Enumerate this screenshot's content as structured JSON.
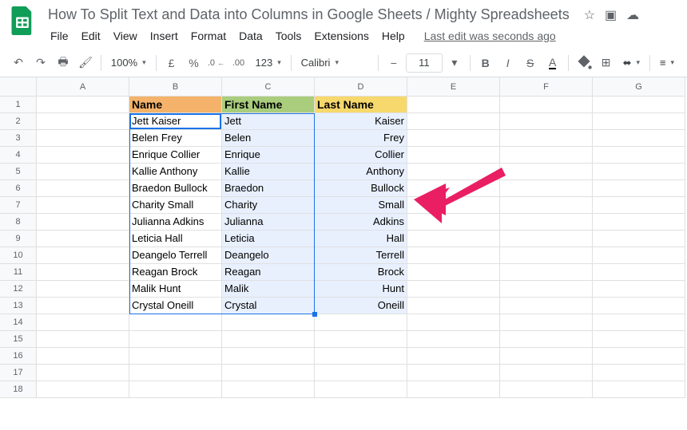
{
  "title": "How To Split Text and Data into Columns in Google Sheets / Mighty Spreadsheets",
  "lastEdit": "Last edit was seconds ago",
  "menus": [
    "File",
    "Edit",
    "View",
    "Insert",
    "Format",
    "Data",
    "Tools",
    "Extensions",
    "Help"
  ],
  "toolbar": {
    "zoom": "100%",
    "currency": "£",
    "percent": "%",
    "dec_dec": ".0",
    "dec_inc": ".00",
    "moreformats": "123",
    "font": "Calibri",
    "fontsize": "11"
  },
  "columns": [
    "A",
    "B",
    "C",
    "D",
    "E",
    "F",
    "G"
  ],
  "headers": {
    "name": "Name",
    "first": "First Name",
    "last": "Last Name"
  },
  "rows": [
    {
      "name": "Jett Kaiser",
      "first": "Jett",
      "last": "Kaiser"
    },
    {
      "name": "Belen Frey",
      "first": "Belen",
      "last": "Frey"
    },
    {
      "name": "Enrique Collier",
      "first": "Enrique",
      "last": "Collier"
    },
    {
      "name": "Kallie Anthony",
      "first": "Kallie",
      "last": "Anthony"
    },
    {
      "name": "Braedon Bullock",
      "first": "Braedon",
      "last": "Bullock"
    },
    {
      "name": "Charity Small",
      "first": "Charity",
      "last": "Small"
    },
    {
      "name": "Julianna Adkins",
      "first": "Julianna",
      "last": "Adkins"
    },
    {
      "name": "Leticia Hall",
      "first": "Leticia",
      "last": "Hall"
    },
    {
      "name": "Deangelo Terrell",
      "first": "Deangelo",
      "last": "Terrell"
    },
    {
      "name": "Reagan Brock",
      "first": "Reagan",
      "last": "Brock"
    },
    {
      "name": "Malik Hunt",
      "first": "Malik",
      "last": "Hunt"
    },
    {
      "name": "Crystal Oneill",
      "first": "Crystal",
      "last": "Oneill"
    }
  ],
  "totalRows": 18
}
